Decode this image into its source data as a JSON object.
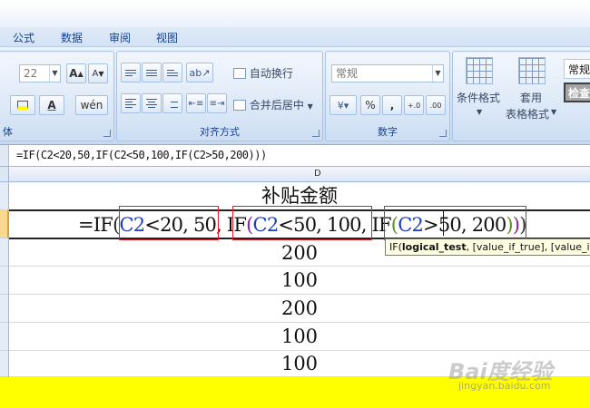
{
  "menu": {
    "tabs": [
      "公式",
      "数据",
      "审阅",
      "视图"
    ]
  },
  "ribbon": {
    "font_group": {
      "label": "体",
      "font_size": "22",
      "grow_font": "A",
      "shrink_font": "A"
    },
    "alignment_group": {
      "label": "对齐方式",
      "wrap_text": "自动换行",
      "merge_center": "合并后居中"
    },
    "number_group": {
      "label": "数字",
      "format_value": "常规",
      "percent": "%",
      "comma": ","
    },
    "styles_group": {
      "conditional_format": "条件格式",
      "format_as_table_line1": "套用",
      "format_as_table_line2": "表格格式",
      "style_normal": "常规",
      "style_check": "检查"
    }
  },
  "formula_bar": {
    "content": "=IF(C2<20,50,IF(C2<50,100,IF(C2>50,200)))"
  },
  "sheet": {
    "column_label": "D",
    "header_cell": "补贴金额",
    "formula_tokens": {
      "t1": "=IF",
      "t2": "(",
      "t3": "C2",
      "t4": "<20, 50",
      "t5": ", IF",
      "t6": "(",
      "t7": "C2",
      "t8": "<50, 100",
      "t9": ", IF",
      "t10": "(",
      "t11": "C2",
      "t12": ">50, 200",
      "t13": ")",
      "t14": ")",
      "t15": ")"
    },
    "values": [
      "200",
      "100",
      "200",
      "100",
      "100"
    ]
  },
  "tooltip": {
    "fn": "IF(",
    "arg1": "logical_test",
    "rest": ", [value_if_true], [value_if_false])"
  },
  "watermark": {
    "brand": "Bai度经验",
    "url": "jingyan.baidu.com"
  },
  "colors": {
    "ref": "#1f3fb8",
    "paren_level1": "#2a2a2a",
    "paren_level2": "#8a1fa0",
    "paren_level3": "#5b8f1c",
    "highlight_box": "#e0202c",
    "footer": "#ffff00"
  }
}
